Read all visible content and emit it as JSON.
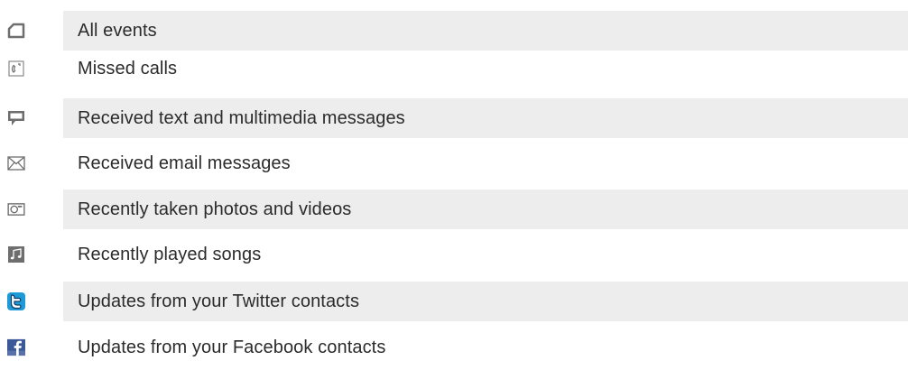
{
  "events": [
    {
      "label": "All events",
      "icon": "home-icon",
      "shaded": true
    },
    {
      "label": "Missed calls",
      "icon": "phone-icon",
      "shaded": false
    },
    {
      "label": "Received text and multimedia messages",
      "icon": "message-icon",
      "shaded": true
    },
    {
      "label": "Received email messages",
      "icon": "envelope-icon",
      "shaded": false
    },
    {
      "label": "Recently taken photos and videos",
      "icon": "camera-icon",
      "shaded": true
    },
    {
      "label": "Recently played songs",
      "icon": "music-note-icon",
      "shaded": false
    },
    {
      "label": "Updates from your Twitter contacts",
      "icon": "twitter-icon",
      "shaded": true
    },
    {
      "label": "Updates from your Facebook contacts",
      "icon": "facebook-icon",
      "shaded": false
    }
  ],
  "colors": {
    "row_shade": "#ededed",
    "text": "#2b2b2b",
    "icon_gray": "#6e6e6e",
    "twitter_blue": "#1e9ad6",
    "facebook_blue": "#3b5998"
  }
}
